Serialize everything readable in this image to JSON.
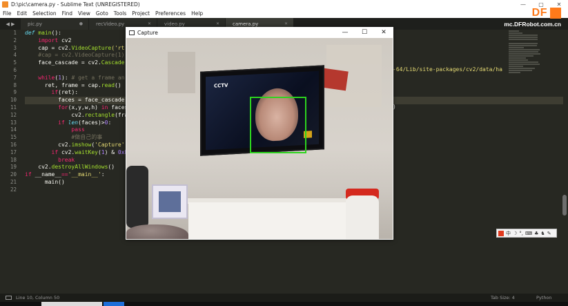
{
  "window": {
    "title": "D:\\pic\\camera.py - Sublime Text (UNREGISTERED)",
    "controls": [
      "—",
      "▢",
      "✕"
    ]
  },
  "menu": [
    "File",
    "Edit",
    "Selection",
    "Find",
    "View",
    "Goto",
    "Tools",
    "Project",
    "Preferences",
    "Help"
  ],
  "watermark": {
    "logo": "DF",
    "site": "mc.DFRobot.com.cn",
    "logo_color": "#ff7a1a"
  },
  "tabs": [
    {
      "label": "pic.py",
      "close": "●"
    },
    {
      "label": "recVideo.py",
      "close": "✕"
    },
    {
      "label": "video.py",
      "close": "✕"
    },
    {
      "label": "camera.py",
      "close": "✕",
      "active": true
    }
  ],
  "code_lines": [
    {
      "n": "1",
      "segs": [
        {
          "t": "def ",
          "c": "def"
        },
        {
          "t": "main",
          "c": "fn"
        },
        {
          "t": "():",
          "c": ""
        }
      ]
    },
    {
      "n": "2",
      "segs": [
        {
          "t": "    import ",
          "c": "kw"
        },
        {
          "t": "cv2",
          "c": ""
        }
      ]
    },
    {
      "n": "3",
      "segs": [
        {
          "t": "    cap = cv2.",
          "c": ""
        },
        {
          "t": "VideoCapture",
          "c": "fn"
        },
        {
          "t": "('rt",
          "c": "str"
        }
      ]
    },
    {
      "n": "4",
      "segs": [
        {
          "t": "    #cap = cv2.VideoCapture(1)",
          "c": "cmt"
        }
      ]
    },
    {
      "n": "5",
      "segs": [
        {
          "t": "    face_cascade = cv2.",
          "c": ""
        },
        {
          "t": "Cascade",
          "c": "fn"
        }
      ]
    },
    {
      "n": "6",
      "segs": []
    },
    {
      "n": "7",
      "segs": [
        {
          "t": "    while",
          "c": "kw"
        },
        {
          "t": "(",
          "c": ""
        },
        {
          "t": "1",
          "c": "num"
        },
        {
          "t": "): ",
          "c": ""
        },
        {
          "t": "# get a frame an",
          "c": "cmt"
        }
      ]
    },
    {
      "n": "8",
      "segs": [
        {
          "t": "      ret, frame = cap.",
          "c": ""
        },
        {
          "t": "read",
          "c": "fn"
        },
        {
          "t": "()",
          "c": ""
        }
      ]
    },
    {
      "n": "9",
      "segs": [
        {
          "t": "        if",
          "c": "kw"
        },
        {
          "t": "(ret):",
          "c": ""
        }
      ]
    },
    {
      "n": "10",
      "segs": [
        {
          "t": "          faces = face_cascade.",
          "c": ""
        },
        {
          "t": "d",
          "c": "fn"
        }
      ],
      "highlight": true
    },
    {
      "n": "11",
      "segs": [
        {
          "t": "          for",
          "c": "kw"
        },
        {
          "t": "(x,y,w,h) ",
          "c": ""
        },
        {
          "t": "in ",
          "c": "kw"
        },
        {
          "t": "faces",
          "c": ""
        }
      ]
    },
    {
      "n": "12",
      "segs": [
        {
          "t": "              cv2.",
          "c": ""
        },
        {
          "t": "rectangle",
          "c": "fn"
        },
        {
          "t": "(frame",
          "c": ""
        }
      ]
    },
    {
      "n": "13",
      "segs": [
        {
          "t": "          if ",
          "c": "kw"
        },
        {
          "t": "len",
          "c": "def"
        },
        {
          "t": "(faces)>",
          "c": ""
        },
        {
          "t": "0",
          "c": "num"
        },
        {
          "t": ":",
          "c": ""
        }
      ]
    },
    {
      "n": "14",
      "segs": [
        {
          "t": "              pass",
          "c": "kw"
        }
      ]
    },
    {
      "n": "15",
      "segs": [
        {
          "t": "              #做自己的事",
          "c": "cmt"
        }
      ]
    },
    {
      "n": "16",
      "segs": [
        {
          "t": "          cv2.",
          "c": ""
        },
        {
          "t": "imshow",
          "c": "fn"
        },
        {
          "t": "(",
          "c": ""
        },
        {
          "t": "'Capture'",
          "c": "str"
        },
        {
          "t": ",",
          "c": ""
        }
      ]
    },
    {
      "n": "17",
      "segs": [
        {
          "t": "        if ",
          "c": "kw"
        },
        {
          "t": "cv2.",
          "c": ""
        },
        {
          "t": "waitKey",
          "c": "fn"
        },
        {
          "t": "(",
          "c": ""
        },
        {
          "t": "1",
          "c": "num"
        },
        {
          "t": ") & ",
          "c": ""
        },
        {
          "t": "0xFF",
          "c": "num"
        }
      ]
    },
    {
      "n": "18",
      "segs": [
        {
          "t": "          break",
          "c": "kw"
        }
      ]
    },
    {
      "n": "19",
      "segs": [
        {
          "t": "    cv2.",
          "c": ""
        },
        {
          "t": "destroyAllWindows",
          "c": "fn"
        },
        {
          "t": "()",
          "c": ""
        }
      ]
    },
    {
      "n": "20",
      "segs": [
        {
          "t": "if ",
          "c": "kw"
        },
        {
          "t": "__name__",
          "c": ""
        },
        {
          "t": "==",
          "c": "kw"
        },
        {
          "t": "'__main__'",
          "c": "str"
        },
        {
          "t": ":",
          "c": ""
        }
      ]
    },
    {
      "n": "21",
      "segs": [
        {
          "t": "      main",
          "c": ""
        },
        {
          "t": "()",
          "c": ""
        }
      ]
    },
    {
      "n": "22",
      "segs": []
    }
  ],
  "code_overflow": {
    "path_tail": "-64/Lib/site-packages/cv2/data/ha",
    "paren_tail": ")"
  },
  "capture_window": {
    "title": "Capture",
    "controls": [
      "—",
      "☐",
      "✕"
    ],
    "tv_logo": "CCTV",
    "detection_box_color": "#2dd41e"
  },
  "ime_toolbar": {
    "items": [
      "中",
      "☽",
      "°,",
      "⌨",
      "♣",
      "♞",
      "✎"
    ]
  },
  "status": {
    "position": "Line 10, Column 50",
    "tab_size": "Tab Size: 4",
    "syntax": "Python"
  }
}
